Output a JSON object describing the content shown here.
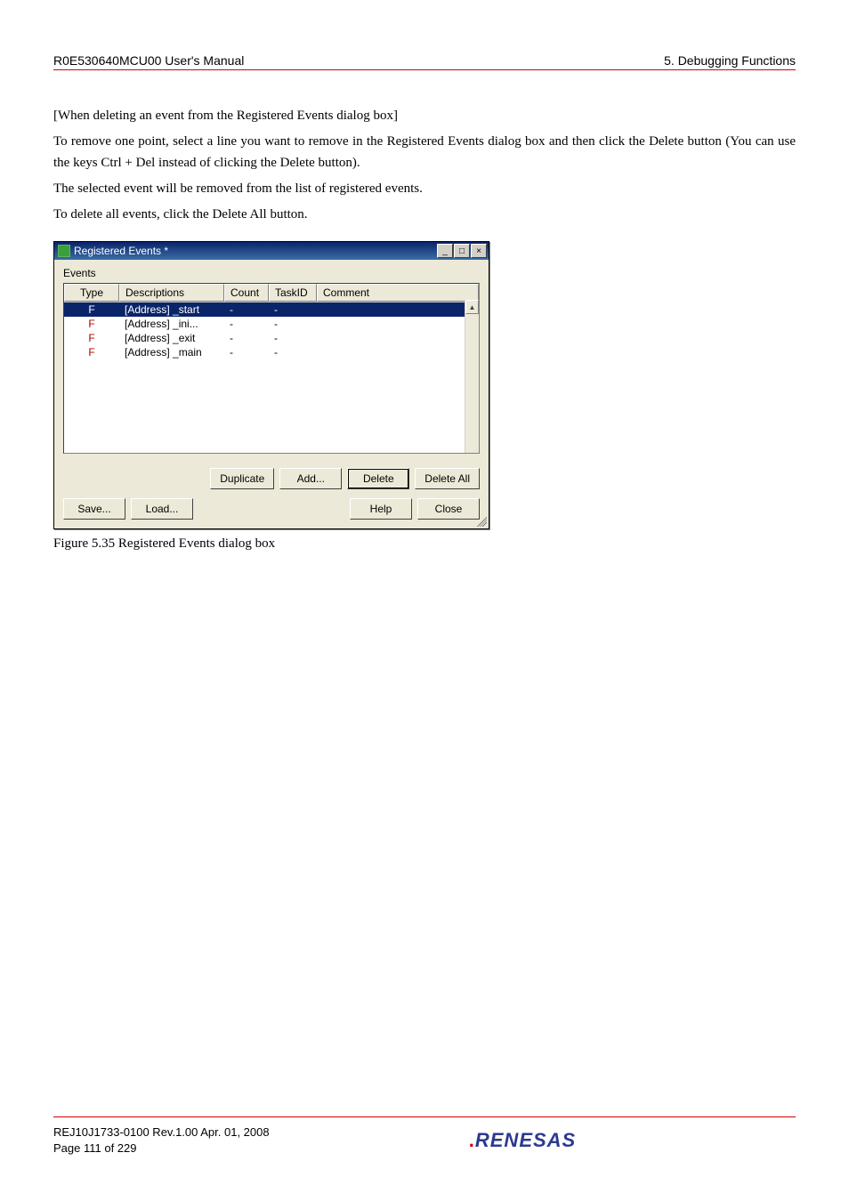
{
  "header": {
    "left": "R0E530640MCU00 User's Manual",
    "right": "5. Debugging Functions"
  },
  "body": {
    "line1": "[When deleting an event from the Registered Events dialog box]",
    "line2": "To remove one point, select a line you want to remove in the Registered Events dialog box and then click the Delete button (You can use the keys Ctrl + Del instead of clicking the Delete button).",
    "line3": "The selected event will be removed from the list of registered events.",
    "line4": "To delete all events, click the Delete All button."
  },
  "dialog": {
    "title": "Registered Events *",
    "events_label": "Events",
    "columns": {
      "type": "Type",
      "descriptions": "Descriptions",
      "count": "Count",
      "taskid": "TaskID",
      "comment": "Comment"
    },
    "rows": [
      {
        "type": "F",
        "desc": "[Address] _start",
        "count": "-",
        "taskid": "-",
        "comment": ""
      },
      {
        "type": "F",
        "desc": "[Address] _ini...",
        "count": "-",
        "taskid": "-",
        "comment": ""
      },
      {
        "type": "F",
        "desc": "[Address] _exit",
        "count": "-",
        "taskid": "-",
        "comment": ""
      },
      {
        "type": "F",
        "desc": "[Address] _main",
        "count": "-",
        "taskid": "-",
        "comment": ""
      }
    ],
    "buttons": {
      "duplicate": "Duplicate",
      "add": "Add...",
      "delete": "Delete",
      "delete_all": "Delete All",
      "save": "Save...",
      "load": "Load...",
      "help": "Help",
      "close": "Close"
    }
  },
  "caption": "Figure 5.35 Registered Events dialog box",
  "footer": {
    "line1": "REJ10J1733-0100   Rev.1.00   Apr. 01, 2008",
    "line2": "Page 111 of 229",
    "logo": "RENESAS"
  }
}
